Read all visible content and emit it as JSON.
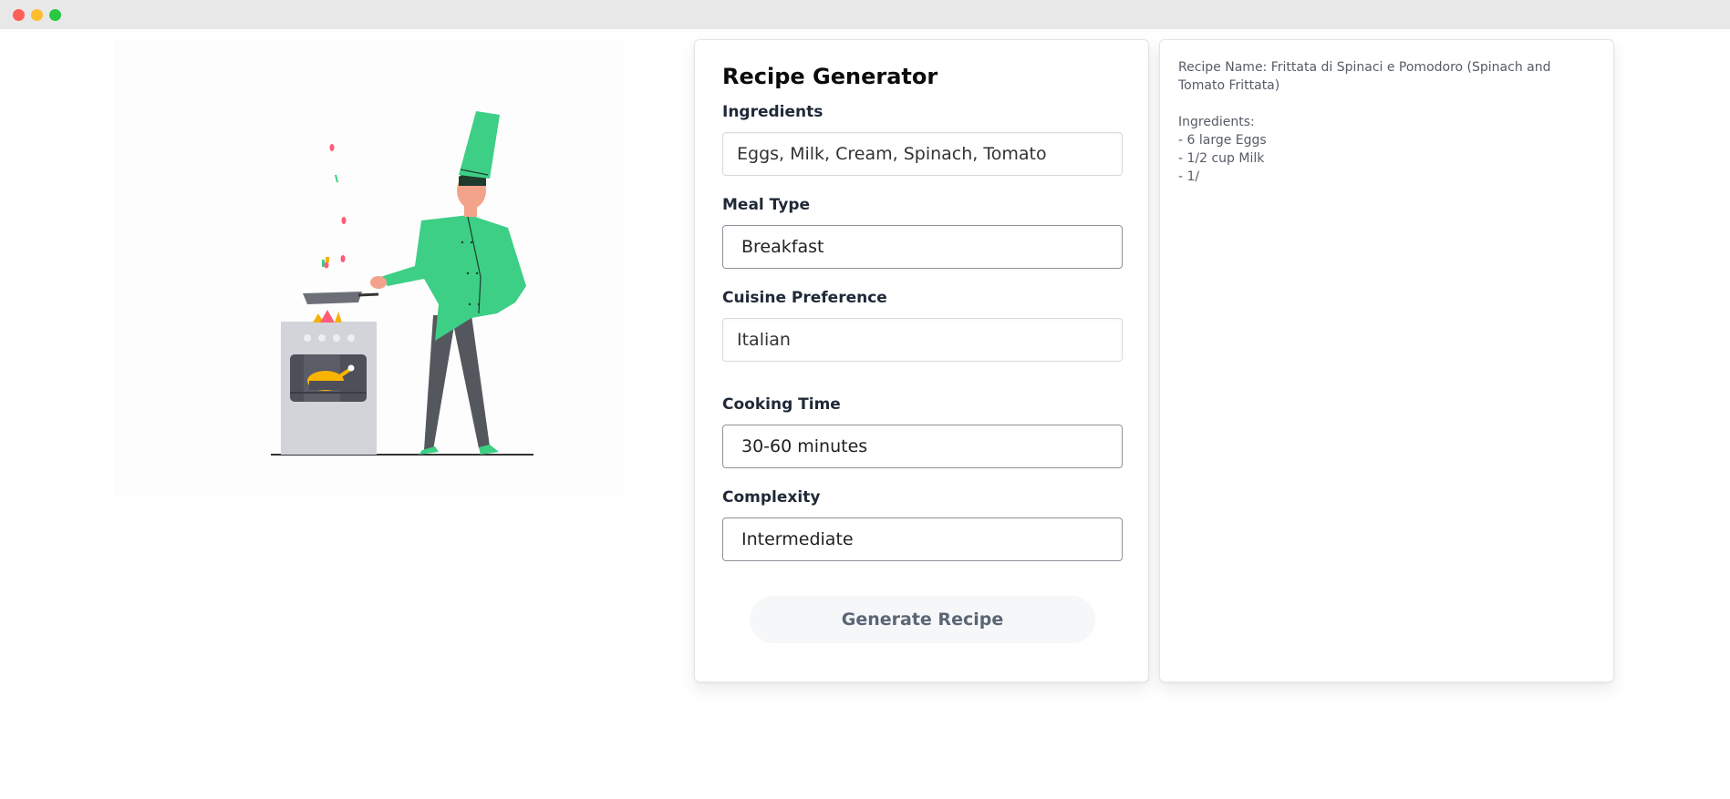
{
  "window": {
    "controls": [
      "close",
      "minimize",
      "maximize"
    ]
  },
  "illustration": {
    "name": "chef-cooking-illustration"
  },
  "form": {
    "title": "Recipe Generator",
    "ingredients": {
      "label": "Ingredients",
      "value": "Eggs, Milk, Cream, Spinach, Tomato"
    },
    "meal_type": {
      "label": "Meal Type",
      "value": "Breakfast"
    },
    "cuisine": {
      "label": "Cuisine Preference",
      "value": "Italian"
    },
    "cooking_time": {
      "label": "Cooking Time",
      "value": "30-60 minutes"
    },
    "complexity": {
      "label": "Complexity",
      "value": "Intermediate"
    },
    "generate_label": "Generate Recipe"
  },
  "result": {
    "lines": [
      "Recipe Name: Frittata di Spinaci e Pomodoro (Spinach and Tomato Frittata)",
      "",
      "Ingredients:",
      "- 6 large Eggs",
      "- 1/2 cup Milk",
      "- 1/"
    ]
  },
  "colors": {
    "accent": "#3ccf85",
    "button_bg": "#f5f7f9",
    "button_text": "#5b6675"
  }
}
